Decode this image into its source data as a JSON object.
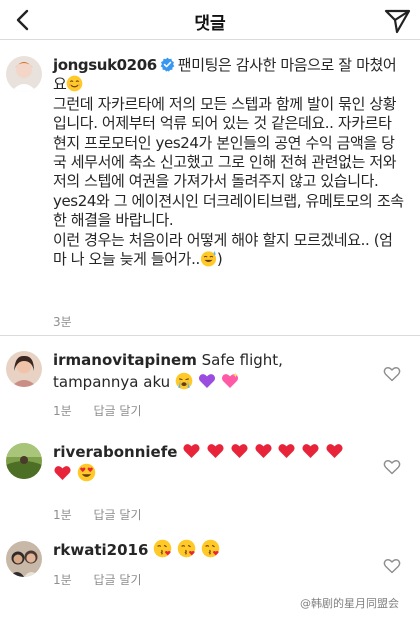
{
  "header": {
    "title": "댓글"
  },
  "caption": {
    "username": "jongsuk0206",
    "first_line": "팬미팅은 감사한 마음으로 잘 마쳤어요",
    "paragraph_1": "그런데 자카르타에 저의 모든 스텝과 함께 발이 묶인 상황입니다. 어제부터 억류 되어 있는 것 같은데요.. 자카르타 현지 프로모터인 yes24가 본인들의 공연 수익 금액을 당국 세무서에 축소 신고했고 그로 인해 전혀 관련없는 저와 저의 스텝에 여권을 가져가서 돌려주지 않고 있습니다.",
    "paragraph_2": "yes24와 그 에이젼시인 더크레이티브랩, 유메토모의 조속한 해결을 바랍니다.",
    "paragraph_3": "이런 경우는 처음이라 어떻게 해야 할지 모르겠네요.. (엄마 나 오늘 늦게 들어가..",
    "paragraph_3_end": ")",
    "time": "3분"
  },
  "comments": [
    {
      "username": "irmanovitapinem",
      "text": "Safe flight, tampannya aku",
      "time": "1분",
      "reply": "답글 달기"
    },
    {
      "username": "riverabonniefe",
      "text": "",
      "time": "1분",
      "reply": "답글 달기"
    },
    {
      "username": "rkwati2016",
      "text": "",
      "time": "1분",
      "reply": "답글 달기"
    }
  ],
  "watermark": "@韩剧的星月同盟会",
  "icons": {
    "back": "chevron-left-icon",
    "send": "paper-plane-icon",
    "verified": "verified-badge-icon",
    "like": "heart-outline-icon"
  },
  "colors": {
    "verified_blue": "#3897f0",
    "heart_red": "#e8243a",
    "purple_heart": "#9b4de0",
    "meta_gray": "#8e8e8e"
  }
}
